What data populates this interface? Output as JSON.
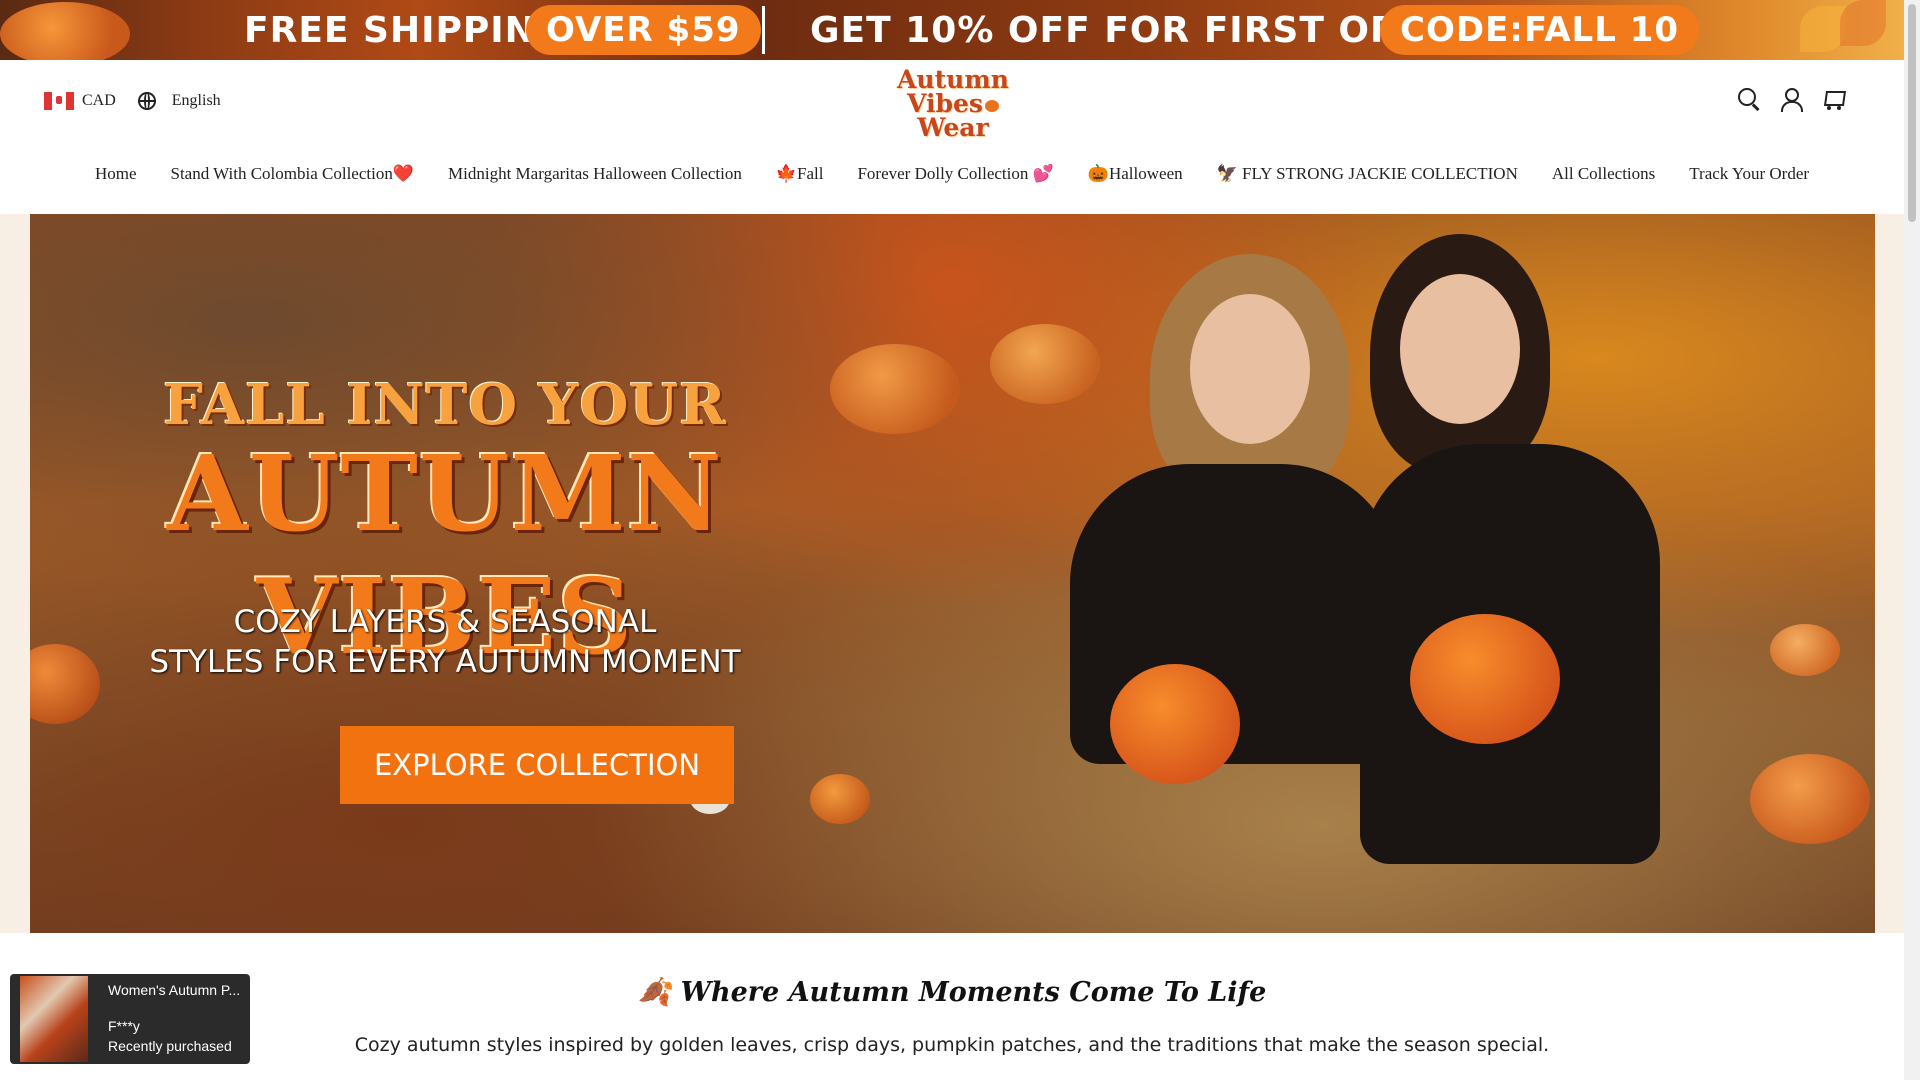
{
  "promo": {
    "shipping_text": "FREE SHIPPING",
    "shipping_pill": "OVER $59",
    "discount_text": "GET 10% OFF FOR FIRST ORDER",
    "code_pill": "CODE:FALL 10"
  },
  "header": {
    "currency": "CAD",
    "language": "English",
    "logo_line1": "Autumn",
    "logo_line2": "Vibes",
    "logo_line3": "Wear"
  },
  "nav": {
    "items": [
      "Home",
      "Stand With Colombia Collection❤️",
      "Midnight Margaritas Halloween Collection",
      "🍁Fall",
      "Forever Dolly Collection 💕",
      "🎃Halloween",
      "🦅 FLY STRONG JACKIE COLLECTION",
      "All Collections",
      "Track Your Order"
    ]
  },
  "hero": {
    "title_line1": "FALL INTO YOUR",
    "title_line2": "AUTUMN VIBES",
    "subtitle_line1": "COZY LAYERS & SEASONAL",
    "subtitle_line2": "STYLES FOR EVERY AUTUMN MOMENT",
    "cta": "EXPLORE COLLECTION"
  },
  "intro": {
    "title": "🍂 Where Autumn Moments Come To Life",
    "text": "Cozy autumn styles inspired by golden leaves, crisp days, pumpkin patches, and the traditions that make the season special."
  },
  "toast": {
    "product": "Women's Autumn P...",
    "name": "F***y",
    "status": "Recently purchased"
  },
  "colors": {
    "accent": "#f2720f",
    "dark": "#222222"
  }
}
